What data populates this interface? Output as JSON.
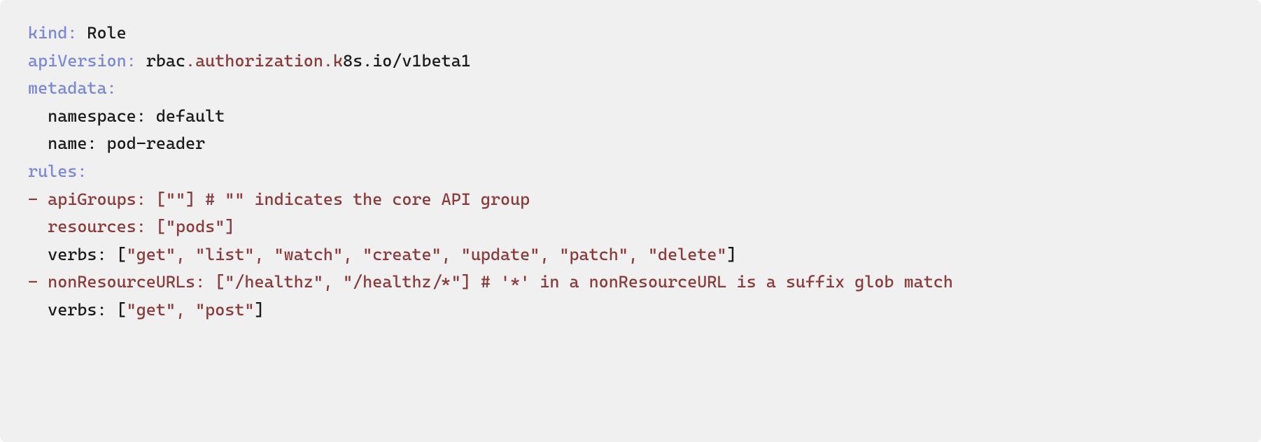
{
  "code": {
    "line1": {
      "key": "kind:",
      "value": " Role"
    },
    "line2": {
      "key": "apiVersion:",
      "prefix": " rbac",
      "dot1": ".",
      "mid1": "authorization",
      "dot2": ".",
      "mid2": "k",
      "rest": "8s.io/v1beta1"
    },
    "line3": {
      "key": "metadata:"
    },
    "line4": {
      "text": "  namespace: default"
    },
    "line5": {
      "text": "  name: pod-reader"
    },
    "line6": {
      "key": "rules:"
    },
    "line7": {
      "dash": "-",
      "text": " apiGroups: [\"\"] # \"\" indicates the core API group"
    },
    "line8": {
      "text": "  resources: [\"pods\"]"
    },
    "line9": {
      "prefix": "  verbs: [",
      "vals": "\"get\", \"list\", \"watch\", \"create\", \"update\", \"patch\", \"delete\"",
      "suffix": "]"
    },
    "line10": {
      "dash": "-",
      "text": " nonResourceURLs: [\"/healthz\", \"/healthz/*\"] # '*' in a nonResourceURL is a suffix glob match"
    },
    "line11": {
      "prefix": "  verbs: [",
      "vals": "\"get\", \"post\"",
      "suffix": "]"
    }
  }
}
